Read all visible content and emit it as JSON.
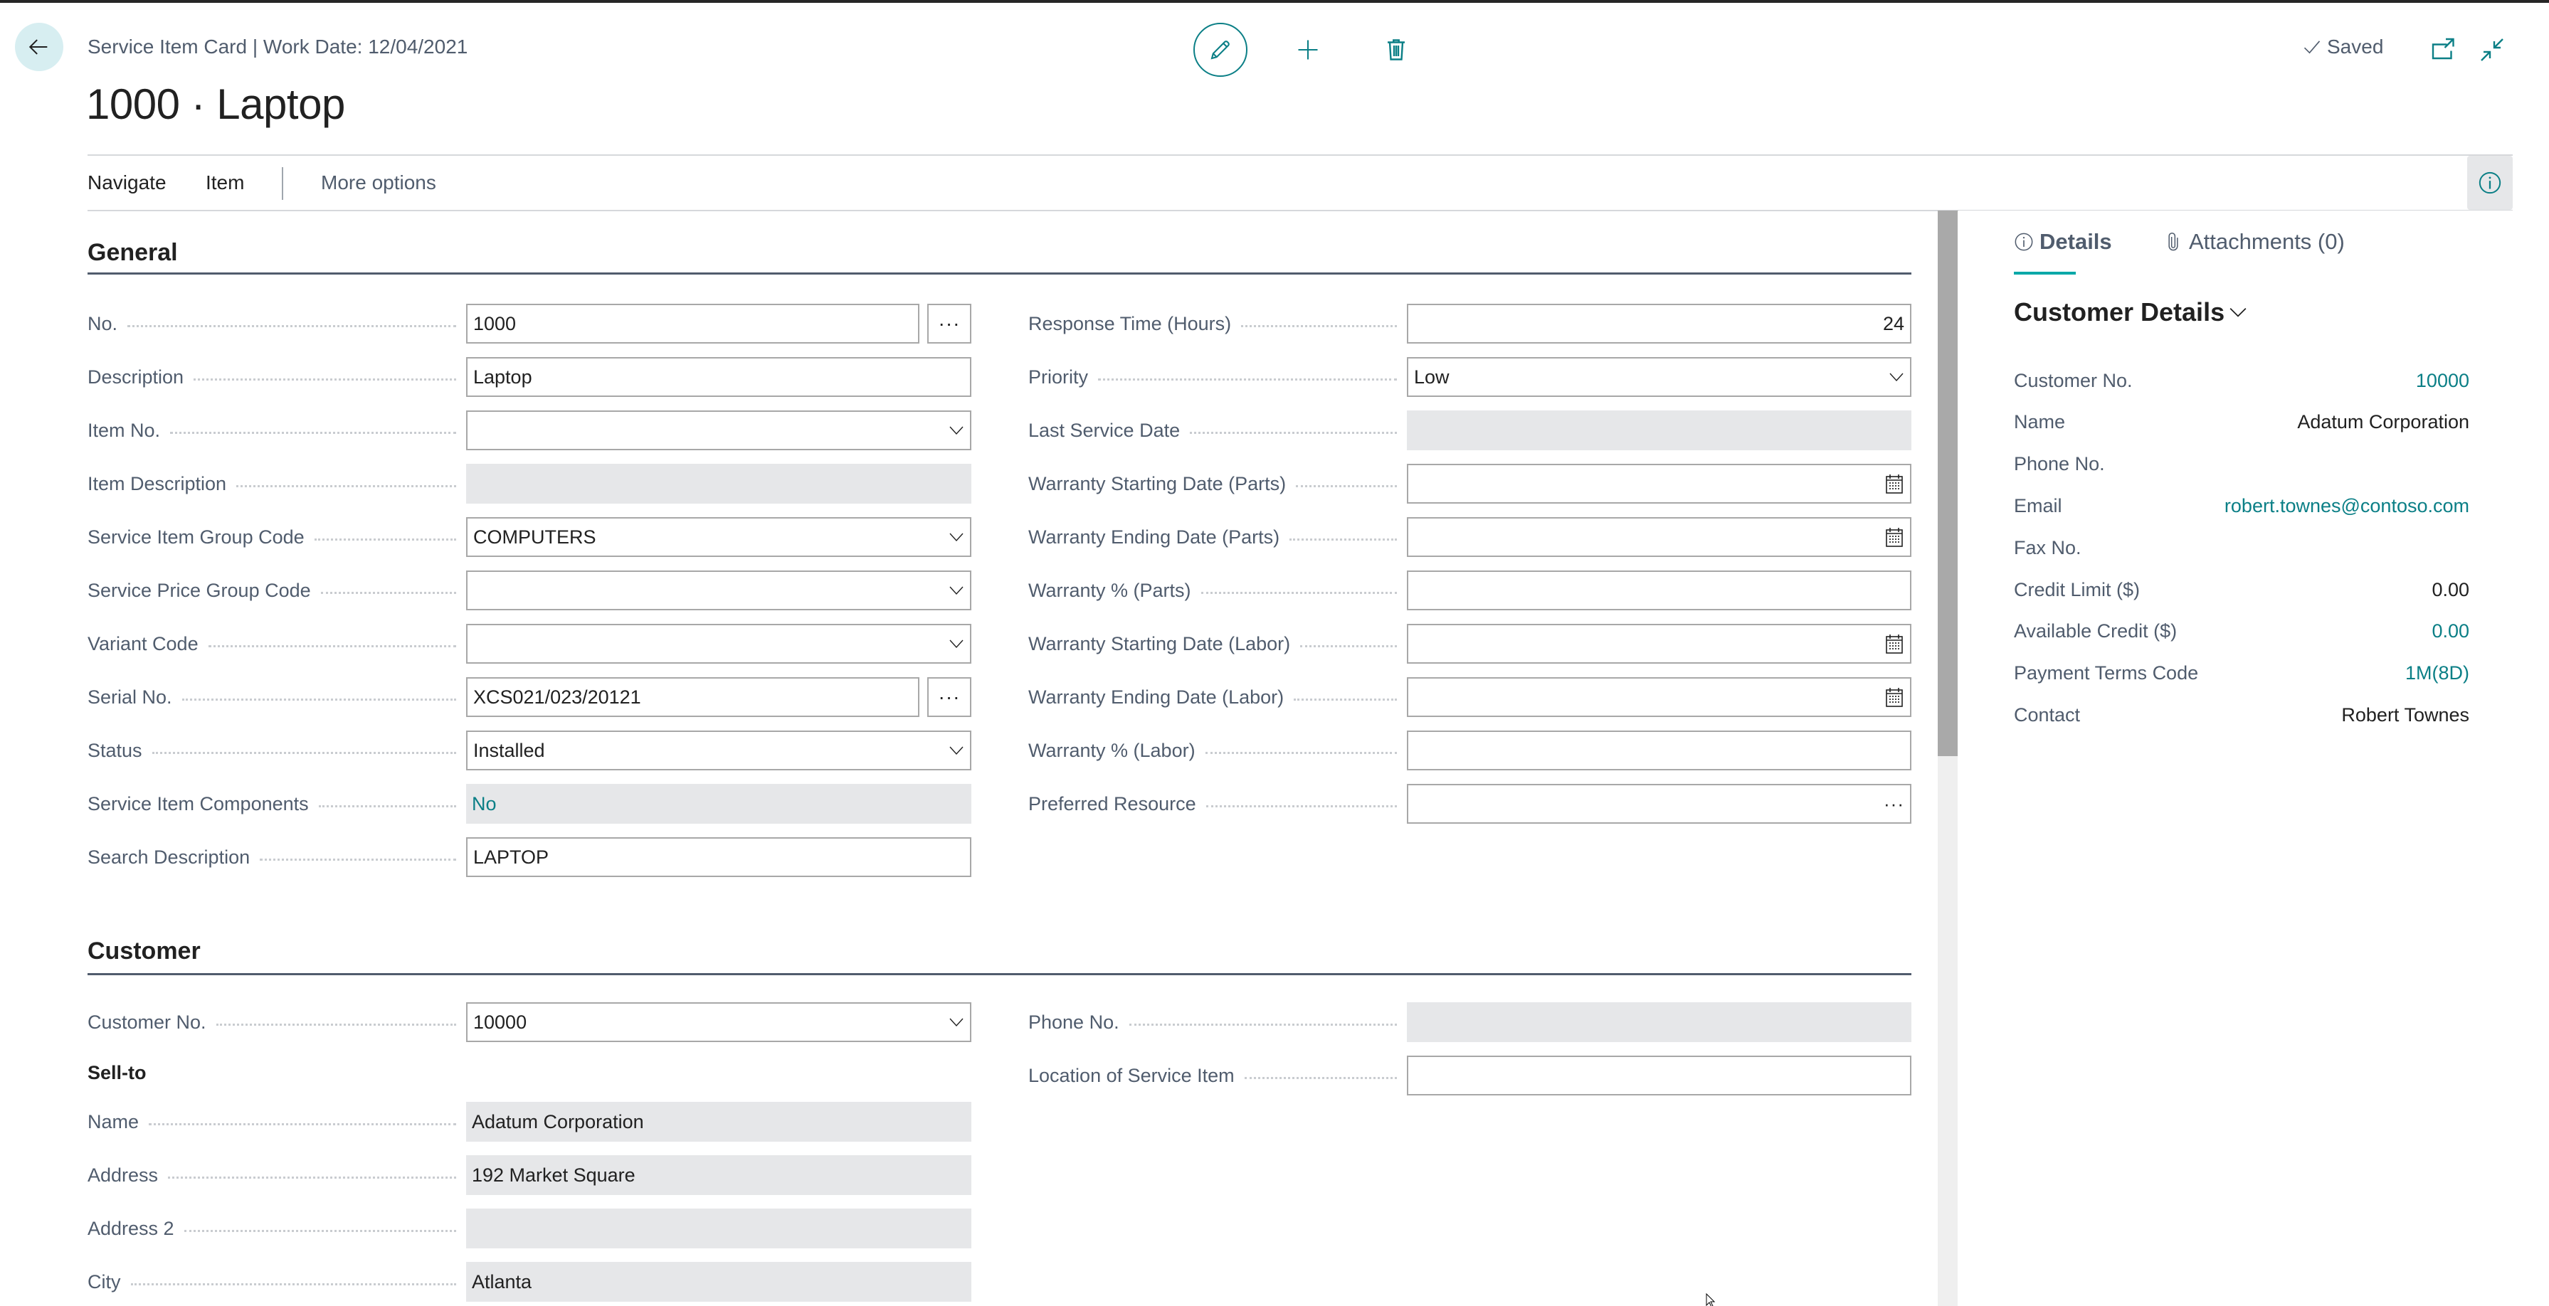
{
  "header": {
    "breadcrumb": "Service Item Card | Work Date: 12/04/2021",
    "title": "1000 · Laptop",
    "saved_status": "Saved",
    "icons": {
      "back": "arrow-left-icon",
      "edit": "pencil-icon",
      "new": "plus-icon",
      "delete": "trash-icon",
      "saved": "checkmark-icon",
      "open_new_window": "open-in-new-window-icon",
      "collapse": "collapse-icon"
    }
  },
  "actionbar": {
    "items": [
      "Navigate",
      "Item"
    ],
    "more_options": "More options",
    "info_icon": "info-icon"
  },
  "general": {
    "title": "General",
    "left_fields": [
      {
        "label": "No.",
        "value": "1000",
        "type": "text-ellipsis"
      },
      {
        "label": "Description",
        "value": "Laptop",
        "type": "text"
      },
      {
        "label": "Item No.",
        "value": "",
        "type": "dropdown"
      },
      {
        "label": "Item Description",
        "value": "",
        "type": "readonly"
      },
      {
        "label": "Service Item Group Code",
        "value": "COMPUTERS",
        "type": "dropdown"
      },
      {
        "label": "Service Price Group Code",
        "value": "",
        "type": "dropdown"
      },
      {
        "label": "Variant Code",
        "value": "",
        "type": "dropdown"
      },
      {
        "label": "Serial No.",
        "value": "XCS021/023/20121",
        "type": "text-ellipsis"
      },
      {
        "label": "Status",
        "value": "Installed",
        "type": "dropdown"
      },
      {
        "label": "Service Item Components",
        "value": "No",
        "type": "readonly-link"
      },
      {
        "label": "Search Description",
        "value": "LAPTOP",
        "type": "text"
      }
    ],
    "right_fields": [
      {
        "label": "Response Time (Hours)",
        "value": "24",
        "type": "number"
      },
      {
        "label": "Priority",
        "value": "Low",
        "type": "dropdown"
      },
      {
        "label": "Last Service Date",
        "value": "",
        "type": "readonly"
      },
      {
        "label": "Warranty Starting Date (Parts)",
        "value": "",
        "type": "date"
      },
      {
        "label": "Warranty Ending Date (Parts)",
        "value": "",
        "type": "date"
      },
      {
        "label": "Warranty % (Parts)",
        "value": "",
        "type": "text"
      },
      {
        "label": "Warranty Starting Date (Labor)",
        "value": "",
        "type": "date"
      },
      {
        "label": "Warranty Ending Date (Labor)",
        "value": "",
        "type": "date"
      },
      {
        "label": "Warranty % (Labor)",
        "value": "",
        "type": "text"
      },
      {
        "label": "Preferred Resource",
        "value": "",
        "type": "lookup"
      }
    ]
  },
  "customer": {
    "title": "Customer",
    "customer_no": {
      "label": "Customer No.",
      "value": "10000"
    },
    "sell_to_label": "Sell-to",
    "sell_to_fields": [
      {
        "label": "Name",
        "value": "Adatum Corporation"
      },
      {
        "label": "Address",
        "value": "192 Market Square"
      },
      {
        "label": "Address 2",
        "value": ""
      },
      {
        "label": "City",
        "value": "Atlanta"
      }
    ],
    "right_fields": [
      {
        "label": "Phone No.",
        "value": "",
        "type": "readonly"
      },
      {
        "label": "Location of Service Item",
        "value": "",
        "type": "text"
      }
    ]
  },
  "factbox": {
    "tabs": [
      {
        "label": "Details",
        "icon": "info-icon",
        "active": true
      },
      {
        "label": "Attachments (0)",
        "icon": "paperclip-icon",
        "active": false
      }
    ],
    "heading": "Customer Details",
    "rows": [
      {
        "label": "Customer No.",
        "value": "10000",
        "link": true
      },
      {
        "label": "Name",
        "value": "Adatum Corporation",
        "link": false
      },
      {
        "label": "Phone No.",
        "value": "",
        "link": false
      },
      {
        "label": "Email",
        "value": "robert.townes@contoso.com",
        "link": true
      },
      {
        "label": "Fax No.",
        "value": "",
        "link": false
      },
      {
        "label": "Credit Limit ($)",
        "value": "0.00",
        "link": false
      },
      {
        "label": "Available Credit ($)",
        "value": "0.00",
        "link": true
      },
      {
        "label": "Payment Terms Code",
        "value": "1M(8D)",
        "link": true
      },
      {
        "label": "Contact",
        "value": "Robert Townes",
        "link": false
      }
    ]
  },
  "colors": {
    "accent": "#0b7f86",
    "tab_underline": "#00a8a8",
    "label": "#505c6d",
    "readonly_bg": "#e6e7e9",
    "input_border": "#a8a8a8"
  }
}
